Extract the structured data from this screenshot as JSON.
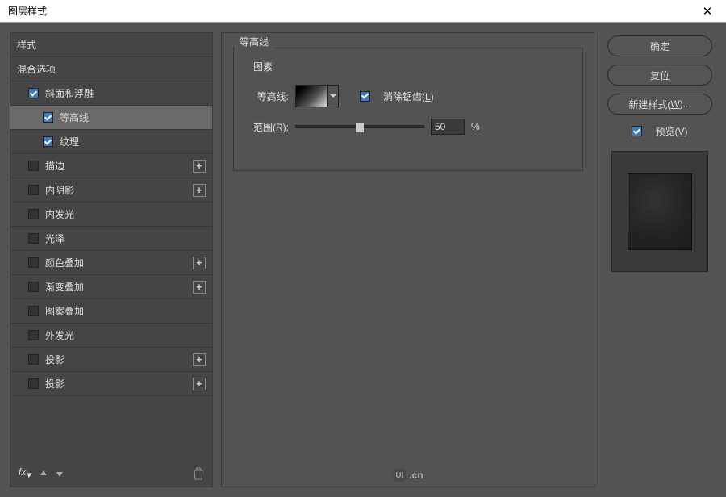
{
  "window": {
    "title": "图层样式"
  },
  "left": {
    "styles_header": "样式",
    "blend_header": "混合选项",
    "items": {
      "bevel": {
        "label": "斜面和浮雕",
        "checked": true
      },
      "contour": {
        "label": "等高线",
        "checked": true
      },
      "texture": {
        "label": "纹理",
        "checked": true
      },
      "stroke": {
        "label": "描边",
        "checked": false
      },
      "inner_shadow": {
        "label": "内阴影",
        "checked": false
      },
      "inner_glow": {
        "label": "内发光",
        "checked": false
      },
      "satin": {
        "label": "光泽",
        "checked": false
      },
      "color_overlay": {
        "label": "颜色叠加",
        "checked": false
      },
      "gradient_overlay": {
        "label": "渐变叠加",
        "checked": false
      },
      "pattern_overlay": {
        "label": "图案叠加",
        "checked": false
      },
      "outer_glow": {
        "label": "外发光",
        "checked": false
      },
      "drop_shadow_1": {
        "label": "投影",
        "checked": false
      },
      "drop_shadow_2": {
        "label": "投影",
        "checked": false
      }
    },
    "fx_label": "fx"
  },
  "center": {
    "section_title": "等高线",
    "group_title": "图素",
    "contour_label": "等高线:",
    "antialias_label": "消除锯齿(",
    "antialias_hotkey": "L",
    "antialias_label_end": ")",
    "range_label": "范围(",
    "range_hotkey": "R",
    "range_label_end": "):",
    "range_value": "50",
    "range_unit": "%"
  },
  "right": {
    "ok": "确定",
    "reset": "复位",
    "new_style": "新建样式(",
    "new_style_hotkey": "W",
    "new_style_end": ")...",
    "preview": "预览(",
    "preview_hotkey": "V",
    "preview_end": ")"
  },
  "watermark": {
    "badge": "UI",
    "suffix": ".cn"
  }
}
